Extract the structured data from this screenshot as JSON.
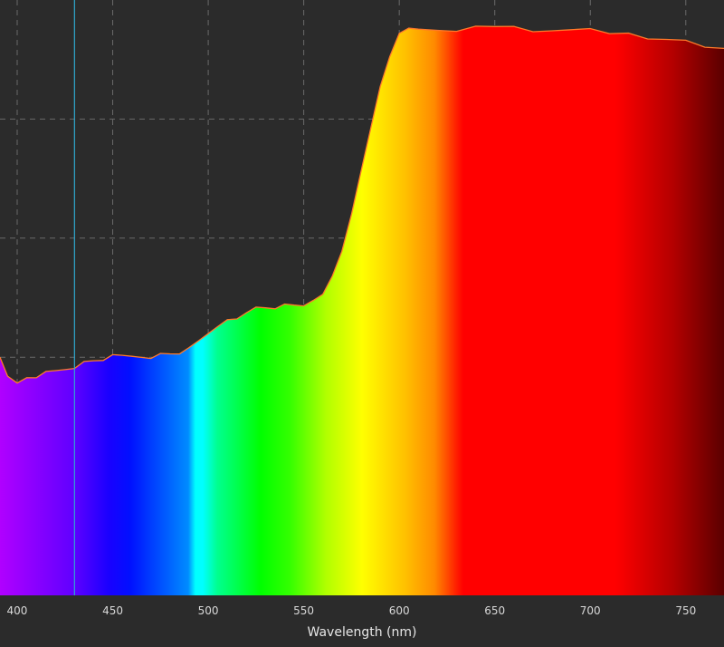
{
  "chart_data": {
    "type": "area",
    "title": "",
    "xlabel": "Wavelength (nm)",
    "ylabel": "",
    "xlim": [
      391,
      770
    ],
    "ylim": [
      0,
      1.0
    ],
    "x_ticks": [
      400,
      450,
      500,
      550,
      600,
      650,
      700,
      750
    ],
    "x_tick_labels": [
      "400",
      "450",
      "500",
      "550",
      "600",
      "650",
      "700",
      "750"
    ],
    "y_gridlines": [
      0.2,
      0.4,
      0.6,
      0.8
    ],
    "grid": true,
    "cursor_x": 430,
    "colors": {
      "background": "#2b2b2b",
      "grid": "#6a6a6a",
      "axis_strip": "#1f1f1f",
      "curve_edge": "#ff7a2a",
      "cursor": "#30a8d0"
    },
    "series": [
      {
        "values": {
          "x": [
            391,
            395,
            400,
            405,
            410,
            415,
            420,
            425,
            430,
            435,
            440,
            445,
            450,
            455,
            460,
            465,
            470,
            475,
            480,
            485,
            490,
            495,
            500,
            505,
            510,
            515,
            520,
            525,
            530,
            535,
            540,
            545,
            550,
            555,
            560,
            565,
            570,
            575,
            580,
            585,
            590,
            595,
            600,
            605,
            610,
            620,
            630,
            640,
            650,
            660,
            670,
            680,
            690,
            700,
            710,
            720,
            730,
            740,
            750,
            760,
            770
          ],
          "y": [
            0.4,
            0.37,
            0.36,
            0.37,
            0.37,
            0.38,
            0.38,
            0.38,
            0.38,
            0.39,
            0.39,
            0.39,
            0.4,
            0.4,
            0.4,
            0.4,
            0.4,
            0.41,
            0.41,
            0.41,
            0.42,
            0.43,
            0.44,
            0.45,
            0.46,
            0.46,
            0.47,
            0.48,
            0.48,
            0.48,
            0.49,
            0.49,
            0.49,
            0.5,
            0.51,
            0.54,
            0.58,
            0.64,
            0.71,
            0.78,
            0.85,
            0.9,
            0.94,
            0.95,
            0.95,
            0.95,
            0.95,
            0.96,
            0.96,
            0.96,
            0.95,
            0.95,
            0.95,
            0.95,
            0.94,
            0.94,
            0.93,
            0.93,
            0.93,
            0.92,
            0.92
          ]
        }
      }
    ]
  }
}
